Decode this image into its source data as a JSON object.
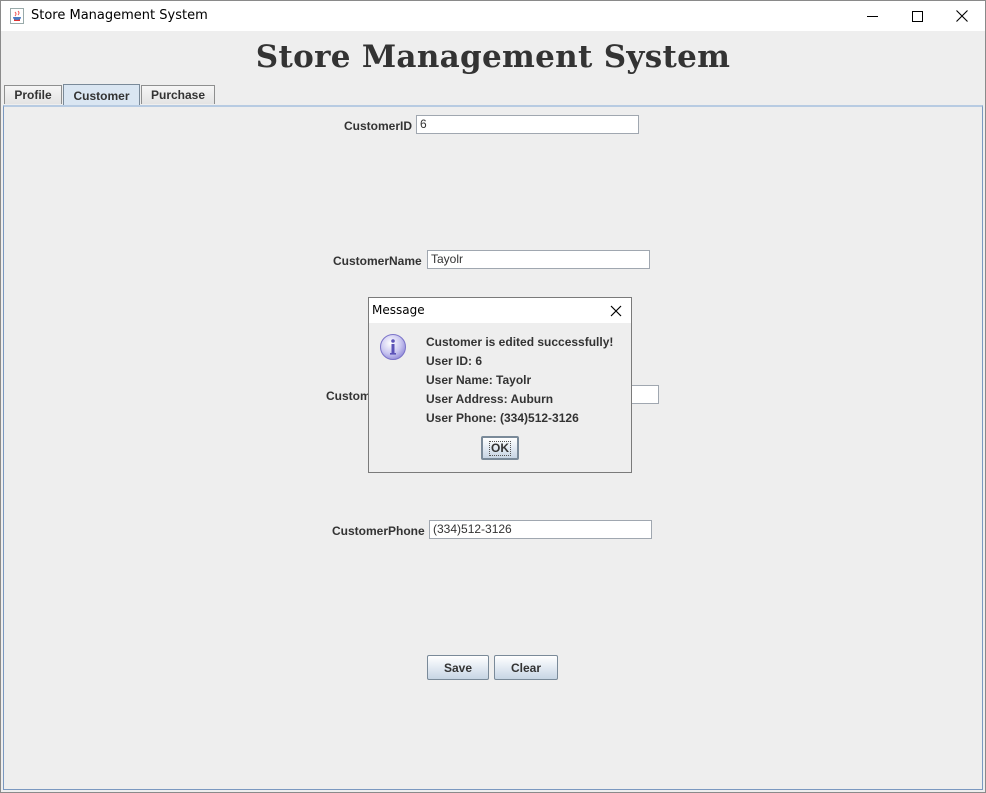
{
  "window": {
    "title": "Store Management System",
    "icon": "java-cup-icon"
  },
  "header": {
    "title": "Store Management System"
  },
  "tabs": [
    {
      "label": "Profile",
      "active": false
    },
    {
      "label": "Customer",
      "active": true
    },
    {
      "label": "Purchase",
      "active": false
    }
  ],
  "form": {
    "customer_id": {
      "label": "CustomerID",
      "value": "6"
    },
    "customer_name": {
      "label": "CustomerName",
      "value": "Tayolr"
    },
    "customer_address": {
      "label": "Custom",
      "value": ""
    },
    "customer_phone": {
      "label": "CustomerPhone",
      "value": "(334)512-3126"
    },
    "save_label": "Save",
    "clear_label": "Clear"
  },
  "dialog": {
    "title": "Message",
    "icon": "info-icon",
    "lines": [
      "Customer is edited successfully!",
      "User ID: 6",
      "User Name: Tayolr",
      "User Address: Auburn",
      "User Phone: (334)512-3126"
    ],
    "ok_label": "OK"
  },
  "colors": {
    "panel_bg": "#eeeeee",
    "active_tab": "#dae6f2",
    "title_text": "#333333"
  }
}
